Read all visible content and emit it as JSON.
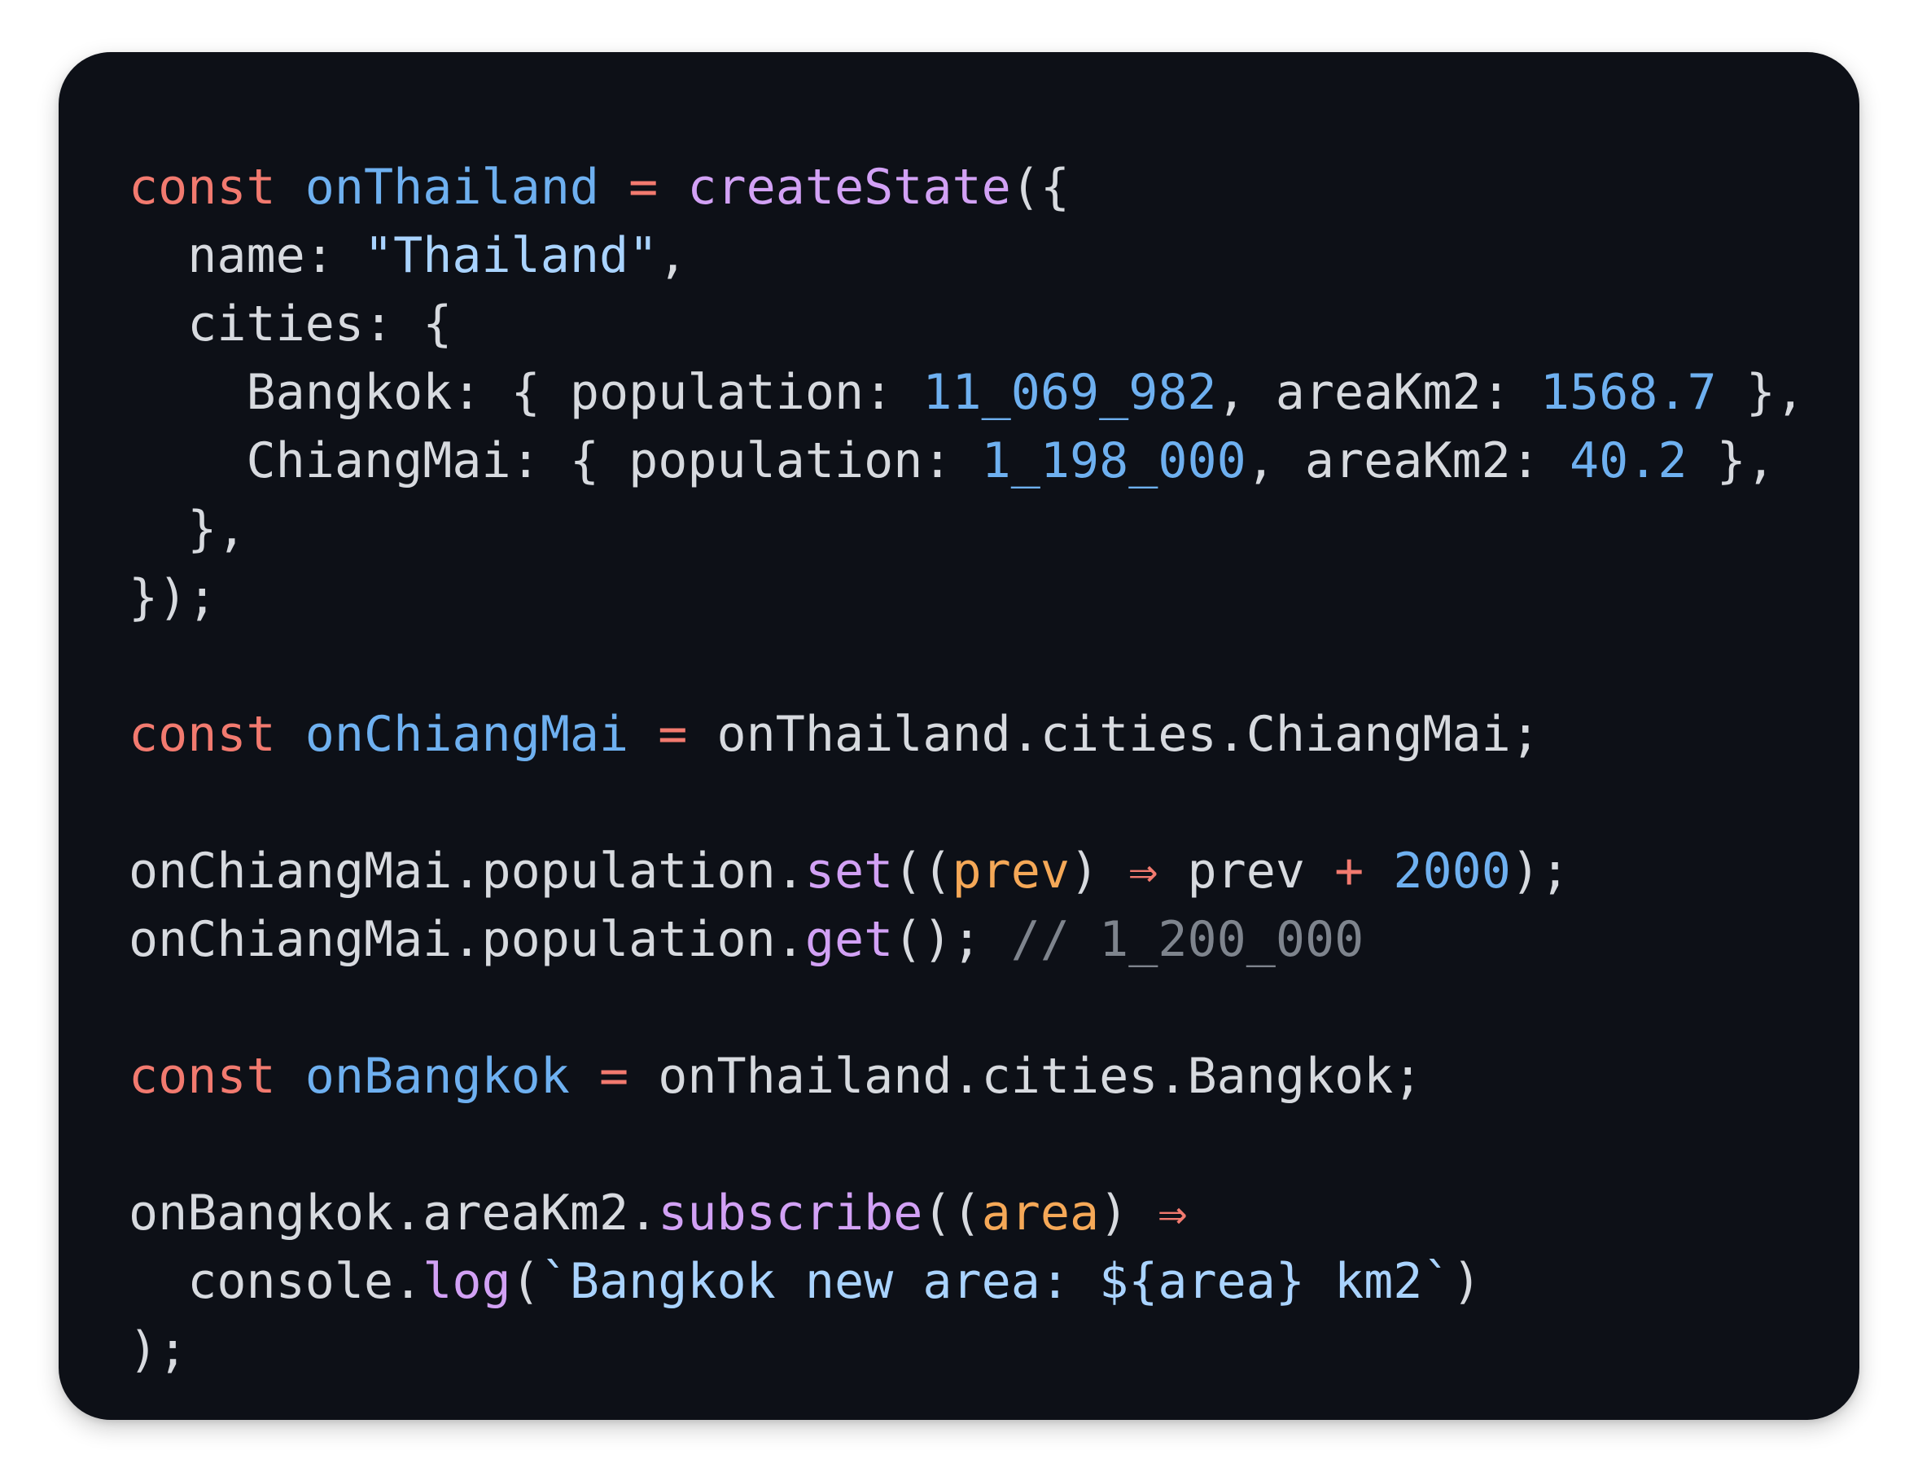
{
  "colors": {
    "background": "#0d1017",
    "keyword": "#f27a6f",
    "variable": "#6eb0f0",
    "function": "#d2a1f5",
    "string": "#a9d3ff",
    "number": "#6eb0f0",
    "parameter": "#f5a857",
    "comment": "#7e848d",
    "plain": "#d7dadf"
  },
  "lines": [
    {
      "type": "line",
      "tokens": [
        {
          "c": "kw",
          "t": "const"
        },
        {
          "c": "pl",
          "t": " "
        },
        {
          "c": "var",
          "t": "onThailand"
        },
        {
          "c": "pl",
          "t": " "
        },
        {
          "c": "op",
          "t": "="
        },
        {
          "c": "pl",
          "t": " "
        },
        {
          "c": "fn",
          "t": "createState"
        },
        {
          "c": "pl",
          "t": "({"
        }
      ]
    },
    {
      "type": "line",
      "tokens": [
        {
          "c": "pl",
          "t": "  name: "
        },
        {
          "c": "str",
          "t": "\"Thailand\""
        },
        {
          "c": "pl",
          "t": ","
        }
      ]
    },
    {
      "type": "line",
      "tokens": [
        {
          "c": "pl",
          "t": "  cities: {"
        }
      ]
    },
    {
      "type": "line",
      "tokens": [
        {
          "c": "pl",
          "t": "    Bangkok: { population: "
        },
        {
          "c": "num",
          "t": "11_069_982"
        },
        {
          "c": "pl",
          "t": ", areaKm2: "
        },
        {
          "c": "num",
          "t": "1568.7"
        },
        {
          "c": "pl",
          "t": " },"
        }
      ]
    },
    {
      "type": "line",
      "tokens": [
        {
          "c": "pl",
          "t": "    ChiangMai: { population: "
        },
        {
          "c": "num",
          "t": "1_198_000"
        },
        {
          "c": "pl",
          "t": ", areaKm2: "
        },
        {
          "c": "num",
          "t": "40.2"
        },
        {
          "c": "pl",
          "t": " },"
        }
      ]
    },
    {
      "type": "line",
      "tokens": [
        {
          "c": "pl",
          "t": "  },"
        }
      ]
    },
    {
      "type": "line",
      "tokens": [
        {
          "c": "pl",
          "t": "});"
        }
      ]
    },
    {
      "type": "gap"
    },
    {
      "type": "line",
      "tokens": [
        {
          "c": "kw",
          "t": "const"
        },
        {
          "c": "pl",
          "t": " "
        },
        {
          "c": "var",
          "t": "onChiangMai"
        },
        {
          "c": "pl",
          "t": " "
        },
        {
          "c": "op",
          "t": "="
        },
        {
          "c": "pl",
          "t": " onThailand.cities.ChiangMai;"
        }
      ]
    },
    {
      "type": "gap"
    },
    {
      "type": "line",
      "tokens": [
        {
          "c": "pl",
          "t": "onChiangMai.population."
        },
        {
          "c": "fn",
          "t": "set"
        },
        {
          "c": "pl",
          "t": "(("
        },
        {
          "c": "prm",
          "t": "prev"
        },
        {
          "c": "pl",
          "t": ") "
        },
        {
          "c": "op",
          "t": "⇒"
        },
        {
          "c": "pl",
          "t": " prev "
        },
        {
          "c": "op",
          "t": "+"
        },
        {
          "c": "pl",
          "t": " "
        },
        {
          "c": "num",
          "t": "2000"
        },
        {
          "c": "pl",
          "t": ");"
        }
      ]
    },
    {
      "type": "line",
      "tokens": [
        {
          "c": "pl",
          "t": "onChiangMai.population."
        },
        {
          "c": "fn",
          "t": "get"
        },
        {
          "c": "pl",
          "t": "(); "
        },
        {
          "c": "cmt",
          "t": "// 1_200_000"
        }
      ]
    },
    {
      "type": "gap"
    },
    {
      "type": "line",
      "tokens": [
        {
          "c": "kw",
          "t": "const"
        },
        {
          "c": "pl",
          "t": " "
        },
        {
          "c": "var",
          "t": "onBangkok"
        },
        {
          "c": "pl",
          "t": " "
        },
        {
          "c": "op",
          "t": "="
        },
        {
          "c": "pl",
          "t": " onThailand.cities.Bangkok;"
        }
      ]
    },
    {
      "type": "gap"
    },
    {
      "type": "line",
      "tokens": [
        {
          "c": "pl",
          "t": "onBangkok.areaKm2."
        },
        {
          "c": "fn",
          "t": "subscribe"
        },
        {
          "c": "pl",
          "t": "(("
        },
        {
          "c": "prm",
          "t": "area"
        },
        {
          "c": "pl",
          "t": ") "
        },
        {
          "c": "op",
          "t": "⇒"
        }
      ]
    },
    {
      "type": "line",
      "tokens": [
        {
          "c": "pl",
          "t": "  console."
        },
        {
          "c": "fn",
          "t": "log"
        },
        {
          "c": "pl",
          "t": "("
        },
        {
          "c": "str",
          "t": "`Bangkok new area: ${area} km2`"
        },
        {
          "c": "pl",
          "t": ")"
        }
      ]
    },
    {
      "type": "line",
      "tokens": [
        {
          "c": "pl",
          "t": ");"
        }
      ]
    }
  ]
}
